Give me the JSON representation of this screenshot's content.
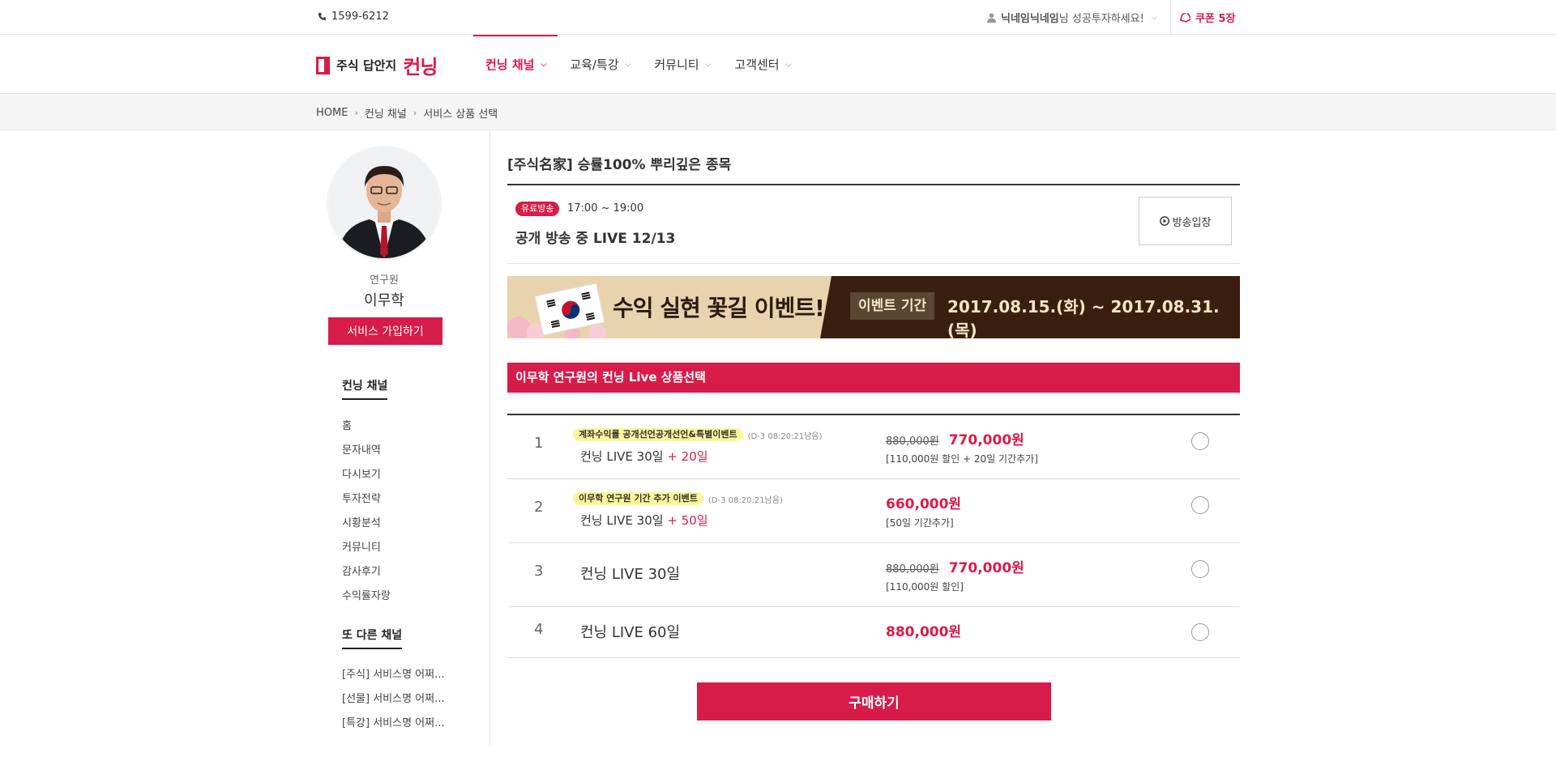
{
  "topbar": {
    "phone": "1599-6212",
    "user_nick": "닉네임닉네임",
    "user_greeting": "님 성공투자하세요!",
    "coupon": "쿠폰 5장"
  },
  "header": {
    "logo_sub": "주식 답안지",
    "logo_main": "컨닝",
    "nav": [
      {
        "label": "컨닝 채널"
      },
      {
        "label": "교육/특강"
      },
      {
        "label": "커뮤니티"
      },
      {
        "label": "고객센터"
      }
    ]
  },
  "breadcrumb": [
    "HOME",
    "컨닝 채널",
    "서비스 상품 선택"
  ],
  "sidebar": {
    "role": "연구원",
    "name": "이무학",
    "join_label": "서비스 가입하기",
    "section1_title": "컨닝 채널",
    "section1_items": [
      "홈",
      "문자내역",
      "다시보기",
      "투자전략",
      "시황분석",
      "커뮤니티",
      "감사후기",
      "수익률자랑"
    ],
    "section2_title": "또 다른 채널",
    "section2_items": [
      "[주식] 서비스명 어쩌...",
      "[선물] 서비스명 어쩌...",
      "[특강] 서비스명 어쩌..."
    ]
  },
  "main": {
    "product_title": "[주식名家] 승률100% 뿌리깊은 종목",
    "live": {
      "badge": "유료방송",
      "time": "17:00 ~ 19:00",
      "title": "공개 방송 중 LIVE 12/13",
      "enter_label": "방송입장"
    },
    "banner": {
      "headline": "수익 실현 꽃길 이벤트!",
      "period_label": "이벤트 기간",
      "period": "2017.08.15.(화) ~ 2017.08.31.(목)"
    },
    "section_title": "이무학 연구원의 컨닝 Live 상품선택",
    "products": [
      {
        "no": "1",
        "tag": "계좌수익률 공개선언공개선언&특별이벤트",
        "dday": "(D-3 08:20:21남음)",
        "name": "컨닝 LIVE 30일",
        "bonus": "+ 20일",
        "orig": "880,000원",
        "price": "770,000원",
        "note": "[110,000원 할인 + 20일 기간추가]"
      },
      {
        "no": "2",
        "tag": "이무학 연구원 기간 추가 이벤트",
        "dday": "(D-3 08:20:21남음)",
        "name": "컨닝 LIVE 30일",
        "bonus": "+ 50일",
        "orig": "",
        "price": "660,000원",
        "note": "[50일 기간추가]"
      },
      {
        "no": "3",
        "tag": "",
        "dday": "",
        "name": "컨닝 LIVE 30일",
        "bonus": "",
        "orig": "880,000원",
        "price": "770,000원",
        "note": "[110,000원 할인]"
      },
      {
        "no": "4",
        "tag": "",
        "dday": "",
        "name": "컨닝 LIVE 60일",
        "bonus": "",
        "orig": "",
        "price": "880,000원",
        "note": ""
      }
    ],
    "buy_label": "구매하기"
  },
  "colors": {
    "accent": "#d81c4a",
    "banner_dark": "#3a1e10",
    "highlight": "#fff59a"
  }
}
